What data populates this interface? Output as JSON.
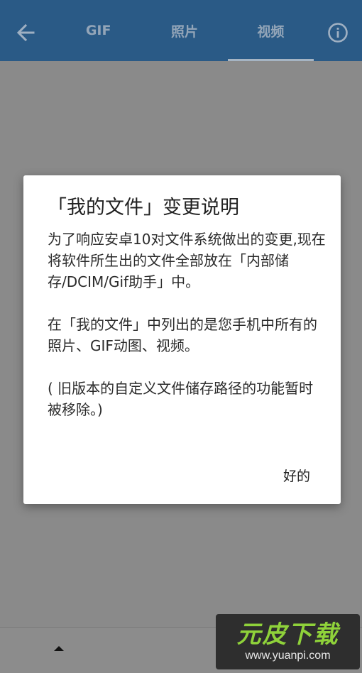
{
  "appbar": {
    "back_icon": "arrow-left-icon",
    "tabs": [
      {
        "label": "GIF",
        "active": false
      },
      {
        "label": "照片",
        "active": false
      },
      {
        "label": "视频",
        "active": true
      }
    ],
    "info_icon": "info-circle-icon",
    "background_color": "#2a5a86"
  },
  "dialog": {
    "title": "「我的文件」变更说明",
    "paragraphs": [
      "为了响应安卓10对文件系统做出的变更,现在将软件所生出的文件全部放在「内部储存/DCIM/Gif助手」中。",
      "在「我的文件」中列出的是您手机中所有的照片、GIF动图、视频。",
      "( 旧版本的自定义文件储存路径的功能暂时被移除。)"
    ],
    "ok_label": "好的"
  },
  "bottombar": {
    "arrow_icon": "caret-up-icon"
  },
  "watermark": {
    "logo_text": "元皮下载",
    "url": "www.yuanpi.com",
    "accent_color": "#8fd23a"
  }
}
